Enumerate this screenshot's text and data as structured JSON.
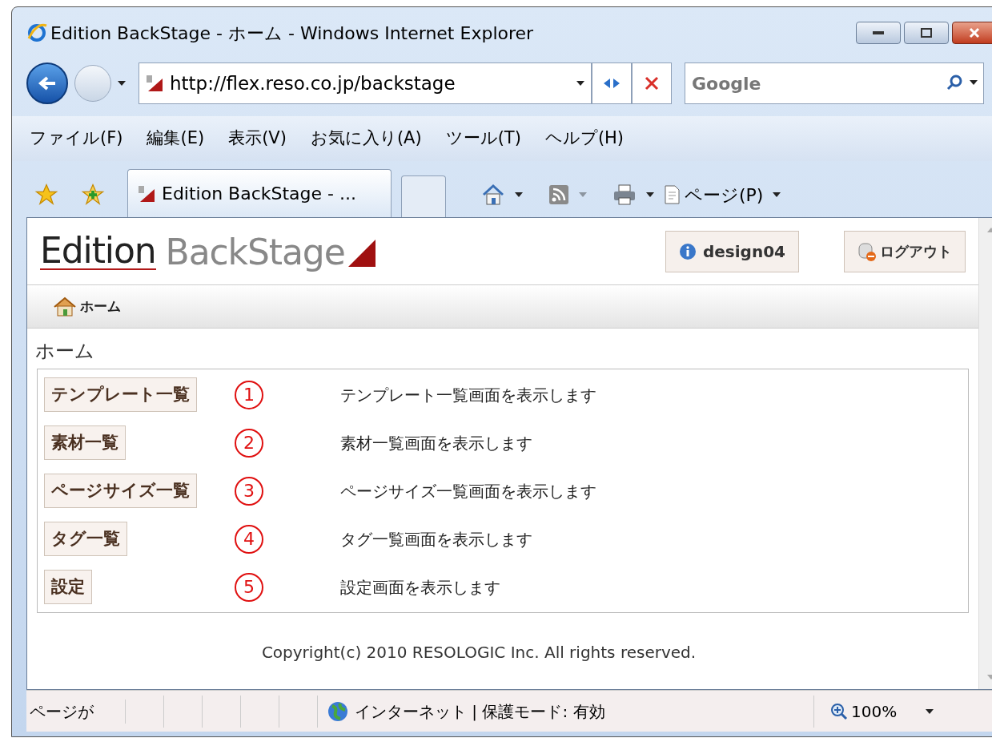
{
  "window": {
    "title": "Edition BackStage - ホーム - Windows Internet Explorer"
  },
  "address_bar": {
    "value": "http://flex.reso.co.jp/backstage"
  },
  "search": {
    "placeholder": "Google"
  },
  "menu": [
    "ファイル(F)",
    "編集(E)",
    "表示(V)",
    "お気に入り(A)",
    "ツール(T)",
    "ヘルプ(H)"
  ],
  "tab": {
    "label": "Edition BackStage - ..."
  },
  "toolbar": {
    "page_menu": "ページ(P)"
  },
  "page": {
    "logo": {
      "word_1": "Edition",
      "word_2": "BackStage"
    },
    "user_button": "design04",
    "logout_button": "ログアウト",
    "breadcrumb": "ホーム",
    "heading": "ホーム",
    "items": [
      {
        "button": "テンプレート一覧",
        "number": "1",
        "description": "テンプレート一覧画面を表示します"
      },
      {
        "button": "素材一覧",
        "number": "2",
        "description": "素材一覧画面を表示します"
      },
      {
        "button": "ページサイズ一覧",
        "number": "3",
        "description": "ページサイズ一覧画面を表示します"
      },
      {
        "button": "タグ一覧",
        "number": "4",
        "description": "タグ一覧画面を表示します"
      },
      {
        "button": "設定",
        "number": "5",
        "description": "設定画面を表示します"
      }
    ],
    "copyright": "Copyright(c) 2010 RESOLOGIC Inc. All rights reserved."
  },
  "status_bar": {
    "text": "ページが",
    "zone": "インターネット | 保護モード: 有効",
    "zoom": "100%"
  }
}
